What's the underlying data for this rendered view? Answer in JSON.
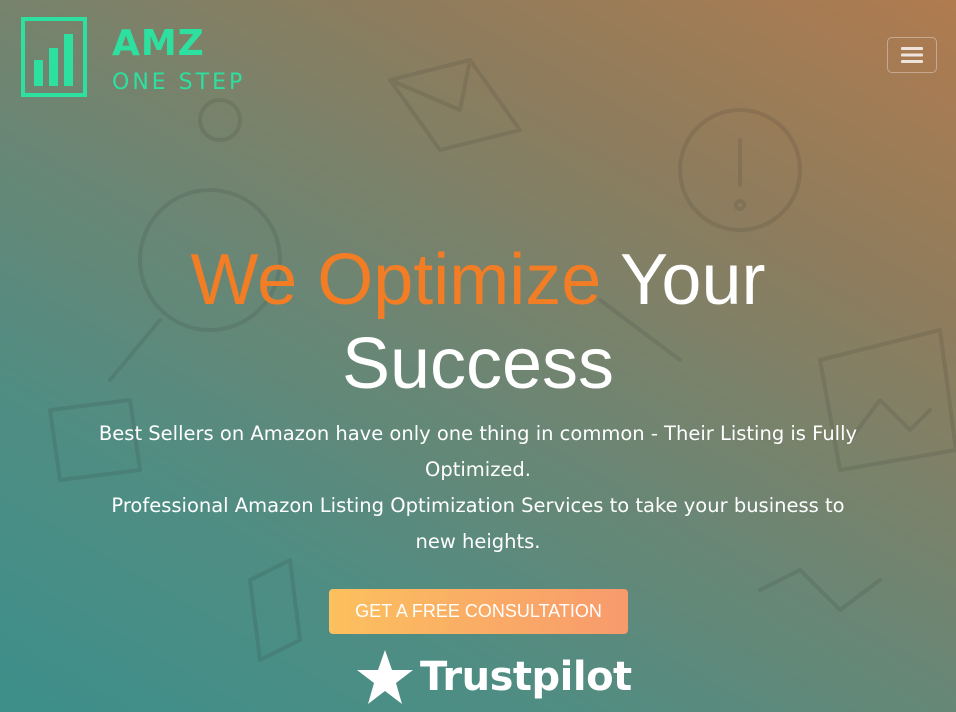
{
  "brand": {
    "name": "AMZ",
    "tagline": "ONE STEP",
    "color": "#2ee0a0"
  },
  "header": {
    "menu_icon": "hamburger-menu-icon"
  },
  "hero": {
    "title_accent": "We Optimize",
    "title_rest_line1": "Your",
    "title_line2": "Success",
    "subtitle_line1": "Best Sellers on Amazon have only one thing in common - Their Listing is Fully Optimized.",
    "subtitle_line2": "Professional Amazon Listing Optimization Services to take your business to new heights.",
    "cta_label": "GET A FREE CONSULTATION",
    "accent_color": "#f27d25"
  },
  "trust": {
    "label": "Trustpilot",
    "icon": "star-icon"
  }
}
